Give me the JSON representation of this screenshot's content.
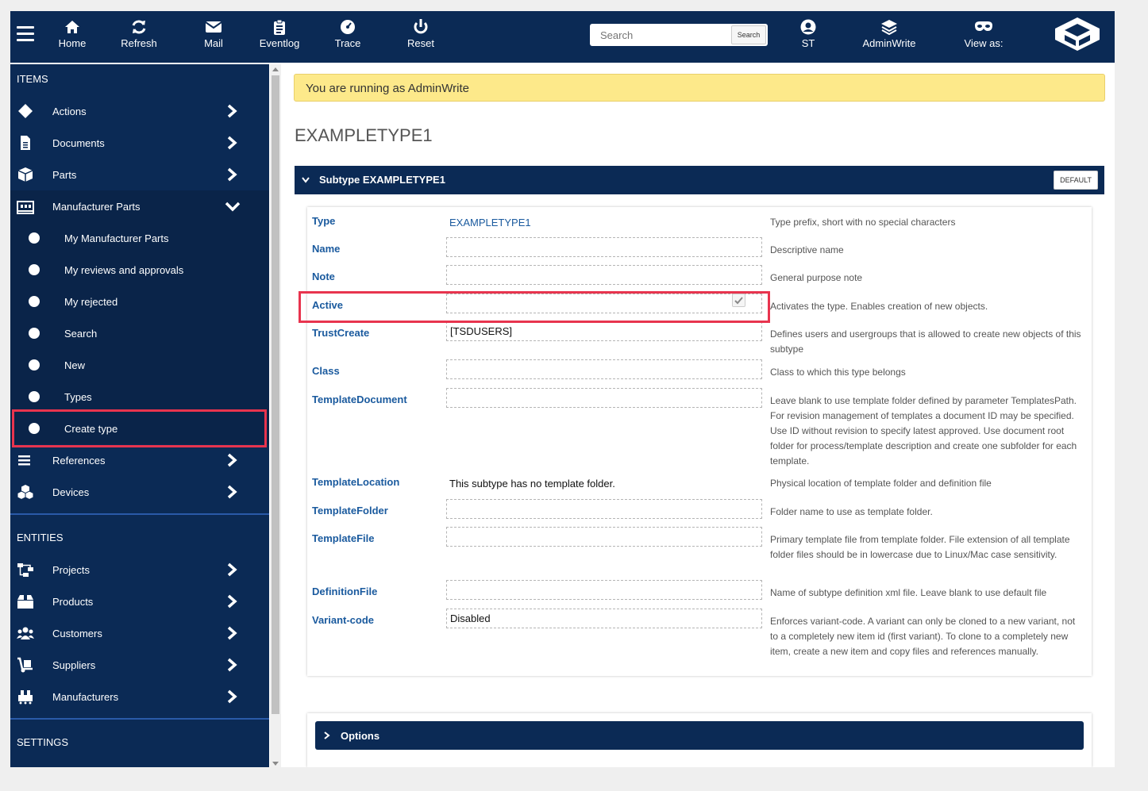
{
  "topbar": {
    "nav": [
      {
        "label": "Home",
        "icon": "home-icon"
      },
      {
        "label": "Refresh",
        "icon": "refresh-icon"
      },
      {
        "label": "Mail",
        "icon": "mail-icon"
      },
      {
        "label": "Eventlog",
        "icon": "clipboard-icon"
      },
      {
        "label": "Trace",
        "icon": "gauge-icon"
      },
      {
        "label": "Reset",
        "icon": "power-icon"
      }
    ],
    "search": {
      "placeholder": "Search",
      "button_label": "Search"
    },
    "user": {
      "label": "ST",
      "icon": "user-icon"
    },
    "role": {
      "label": "AdminWrite",
      "icon": "layers-icon"
    },
    "view_as": {
      "label": "View as:",
      "icon": "mask-icon"
    },
    "logo": "cube-logo"
  },
  "sidebar": {
    "sections": {
      "items": "ITEMS",
      "entities": "ENTITIES",
      "settings": "SETTINGS"
    },
    "items": [
      {
        "label": "Actions",
        "icon": "diamond-icon"
      },
      {
        "label": "Documents",
        "icon": "document-icon"
      },
      {
        "label": "Parts",
        "icon": "cube-icon"
      },
      {
        "label": "Manufacturer Parts",
        "icon": "factory-icon"
      }
    ],
    "sub_items": [
      {
        "label": "My Manufacturer Parts"
      },
      {
        "label": "My reviews and approvals"
      },
      {
        "label": "My rejected"
      },
      {
        "label": "Search"
      },
      {
        "label": "New"
      },
      {
        "label": "Types"
      },
      {
        "label": "Create type"
      }
    ],
    "items2": [
      {
        "label": "References",
        "icon": "list-icon"
      },
      {
        "label": "Devices",
        "icon": "cubes-icon"
      }
    ],
    "entities": [
      {
        "label": "Projects",
        "icon": "sitemap-icon"
      },
      {
        "label": "Products",
        "icon": "box-icon"
      },
      {
        "label": "Customers",
        "icon": "users-icon"
      },
      {
        "label": "Suppliers",
        "icon": "dolly-icon"
      },
      {
        "label": "Manufacturers",
        "icon": "industry-icon"
      }
    ]
  },
  "main": {
    "banner": "You are running as AdminWrite",
    "title": "EXAMPLETYPE1",
    "panel_title": "Subtype EXAMPLETYPE1",
    "default_button": "DEFAULT",
    "options_label": "Options",
    "fields": {
      "type": {
        "label": "Type",
        "value": "EXAMPLETYPE1",
        "desc": "Type prefix, short with no special characters"
      },
      "name": {
        "label": "Name",
        "value": "",
        "desc": "Descriptive name"
      },
      "note": {
        "label": "Note",
        "value": "",
        "desc": "General purpose note"
      },
      "active": {
        "label": "Active",
        "checked": true,
        "desc": "Activates the type. Enables creation of new objects."
      },
      "trustcreate": {
        "label": "TrustCreate",
        "value": "[TSDUSERS]",
        "desc": "Defines users and usergroups that is allowed to create new objects of this subtype"
      },
      "class": {
        "label": "Class",
        "value": "",
        "desc": "Class to which this type belongs"
      },
      "templatedocument": {
        "label": "TemplateDocument",
        "value": "",
        "desc": "Leave blank to use template folder defined by parameter TemplatesPath. For revision management of templates a document ID may be specified. Use ID without revision to specify latest approved. Use document root folder for process/template description and create one subfolder for each template."
      },
      "templatelocation": {
        "label": "TemplateLocation",
        "value": "This subtype has no template folder.",
        "desc": "Physical location of template folder and definition file"
      },
      "templatefolder": {
        "label": "TemplateFolder",
        "value": "",
        "desc": "Folder name to use as template folder."
      },
      "templatefile": {
        "label": "TemplateFile",
        "value": "",
        "desc": "Primary template file from template folder. File extension of all template folder files should be in lowercase due to Linux/Mac case sensitivity."
      },
      "definitionfile": {
        "label": "DefinitionFile",
        "value": "",
        "desc": "Name of subtype definition xml file. Leave blank to use default file"
      },
      "variantcode": {
        "label": "Variant-code",
        "value": "Disabled",
        "desc": "Enforces variant-code. A variant can only be cloned to a new variant, not to a completely new item id (first variant). To clone to a completely new item, create a new item and copy files and references manually."
      }
    }
  },
  "colors": {
    "navy": "#0b2a55",
    "label_blue": "#1a5a9e",
    "banner_yellow": "#fde98a",
    "highlight_red": "#e8344e"
  }
}
